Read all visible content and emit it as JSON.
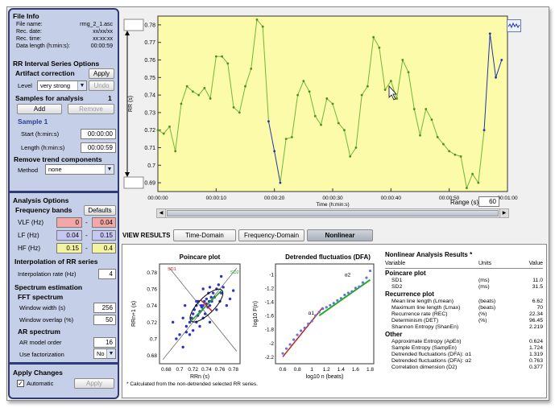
{
  "file_info": {
    "title": "File Info",
    "rows": [
      {
        "label": "File name:",
        "value": "rrng_2_1.asc"
      },
      {
        "label": "Rec. date:",
        "value": "xx/xx/xx"
      },
      {
        "label": "Rec. time:",
        "value": "xx:xx:xx"
      },
      {
        "label": "Data length (h:min:s):",
        "value": "00:00:59"
      }
    ]
  },
  "rr_options": {
    "title": "RR Interval Series Options",
    "artifact_label": "Artifact correction",
    "apply_label": "Apply",
    "level_label": "Level",
    "level_value": "very strong",
    "undo_label": "Undo",
    "samples_label": "Samples for analysis",
    "samples_count": "1",
    "add_label": "Add",
    "remove_label": "Remove",
    "sample_title": "Sample 1",
    "start_label": "Start (h:min:s)",
    "start_value": "00:00:00",
    "length_label": "Length (h:min:s)",
    "length_value": "00:00:59",
    "trend_label": "Remove trend components",
    "method_label": "Method",
    "method_value": "none"
  },
  "analysis": {
    "title": "Analysis Options",
    "freq_label": "Frequency bands",
    "defaults_label": "Defaults",
    "bands": [
      {
        "label": "VLF (Hz)",
        "lo": "0",
        "hi": "0.04",
        "color": "#f4a7a7"
      },
      {
        "label": "LF (Hz)",
        "lo": "0.04",
        "hi": "0.15",
        "color": "#c7c7f4"
      },
      {
        "label": "HF (Hz)",
        "lo": "0.15",
        "hi": "0.4",
        "color": "#f4f4a0"
      }
    ],
    "interp_title": "Interpolation of RR series",
    "interp_label": "Interpolation rate (Hz)",
    "interp_value": "4",
    "spectrum_title": "Spectrum estimation",
    "fft_title": "FFT spectrum",
    "window_label": "Window width (s)",
    "window_value": "256",
    "overlap_label": "Window overlap (%)",
    "overlap_value": "50",
    "ar_title": "AR spectrum",
    "ar_order_label": "AR model order",
    "ar_order_value": "16",
    "fact_label": "Use factorization",
    "fact_value": "No"
  },
  "apply_changes": {
    "title": "Apply Changes",
    "auto_label": "Automatic",
    "apply_label": "Apply"
  },
  "rr_plot": {
    "ylabel": "RR (s)",
    "xlabel": "Time (h:min:s)",
    "yticks": [
      "0.78",
      "0.77",
      "0.76",
      "0.75",
      "0.74",
      "0.73",
      "0.72",
      "0.71",
      "0.7",
      "0.69"
    ],
    "xticks": [
      "00:00:00",
      "00:00:10",
      "00:00:20",
      "00:00:30",
      "00:00:40",
      "00:00:50",
      "00:01:00"
    ],
    "range_label": "Range (s)",
    "range_value": "60",
    "colors": {
      "bg": "#fbfbaa",
      "line": "#6fb83a",
      "selected": "#2233aa"
    }
  },
  "view_results": {
    "label": "VIEW RESULTS",
    "tabs": [
      "Time-Domain",
      "Frequency-Domain",
      "Nonlinear"
    ],
    "active": 2
  },
  "poincare": {
    "title": "Poincare plot",
    "ylabel": "RRn+1 (s)",
    "xlabel": "RRn (s)",
    "xticks": [
      "0.68",
      "0.7",
      "0.72",
      "0.74",
      "0.76",
      "0.78"
    ],
    "yticks": [
      "0.78",
      "0.76",
      "0.74",
      "0.72",
      "0.7",
      "0.68"
    ],
    "sd1_label": "SD1",
    "sd2_label": "SD2"
  },
  "dfa": {
    "title": "Detrended fluctuatios (DFA)",
    "ylabel": "log10 F(n)",
    "xlabel": "log10 n (beats)",
    "xticks": [
      "0.6",
      "0.8",
      "1",
      "1.2",
      "1.4",
      "1.6",
      "1.8"
    ],
    "yticks": [
      "-1",
      "-1.2",
      "-1.4",
      "-1.6",
      "-1.8",
      "-2",
      "-2.2"
    ],
    "alpha1": "α1",
    "alpha2": "α2"
  },
  "nonlinear": {
    "title": "Nonlinear Analysis Results",
    "asterisk": "*",
    "headers": [
      "Variable",
      "Units",
      "Value"
    ],
    "sections": [
      {
        "title": "Poincare plot",
        "rows": [
          {
            "name": "SD1",
            "unit": "(ms)",
            "value": "11.0"
          },
          {
            "name": "SD2",
            "unit": "(ms)",
            "value": "31.5"
          }
        ]
      },
      {
        "title": "Recurrence plot",
        "rows": [
          {
            "name": "Mean line length (Lmean)",
            "unit": "(beats)",
            "value": "6.62"
          },
          {
            "name": "Maximum line length (Lmax)",
            "unit": "(beats)",
            "value": "70"
          },
          {
            "name": "Recurrence rate (REC)",
            "unit": "(%)",
            "value": "22.34"
          },
          {
            "name": "Determinism (DET)",
            "unit": "(%)",
            "value": "96.45"
          },
          {
            "name": "Shannon Entropy (ShanEn)",
            "unit": "",
            "value": "2.219"
          }
        ]
      },
      {
        "title": "Other",
        "rows": [
          {
            "name": "Approximate Entropy (ApEn)",
            "unit": "",
            "value": "0.624"
          },
          {
            "name": "Sample Entropy (SampEn)",
            "unit": "",
            "value": "1.724"
          },
          {
            "name": "Detrended fluctuations (DFA): α1",
            "unit": "",
            "value": "1.319"
          },
          {
            "name": "Detrended fluctuations (DFA): α2",
            "unit": "",
            "value": "0.763"
          },
          {
            "name": "Correlation dimension (D2)",
            "unit": "",
            "value": "0.377"
          }
        ]
      }
    ],
    "footnote": "* Calculated from the non-detrended selected RR series."
  },
  "chart_data": [
    {
      "type": "line",
      "name": "rr-series",
      "x_unit": "s",
      "xlim": [
        0,
        60
      ],
      "ylim": [
        0.685,
        0.785
      ],
      "x": [
        0,
        1,
        2,
        3,
        4,
        5,
        6,
        7,
        8,
        9,
        10,
        11,
        12,
        13,
        14,
        15,
        16,
        17,
        18,
        19,
        20,
        21,
        22,
        23,
        24,
        25,
        26,
        27,
        28,
        29,
        30,
        31,
        32,
        33,
        34,
        35,
        36,
        37,
        38,
        39,
        40,
        41,
        42,
        43,
        44,
        45,
        46,
        47,
        48,
        49,
        50,
        51,
        52,
        53,
        54,
        55,
        56,
        57,
        58,
        59
      ],
      "y": [
        0.72,
        0.718,
        0.722,
        0.708,
        0.735,
        0.745,
        0.742,
        0.74,
        0.744,
        0.738,
        0.762,
        0.762,
        0.758,
        0.733,
        0.73,
        0.745,
        0.755,
        0.783,
        0.779,
        0.725,
        0.708,
        0.69,
        0.715,
        0.716,
        0.74,
        0.748,
        0.742,
        0.728,
        0.723,
        0.738,
        0.735,
        0.724,
        0.72,
        0.705,
        0.71,
        0.74,
        0.745,
        0.773,
        0.767,
        0.743,
        0.748,
        0.738,
        0.76,
        0.753,
        0.732,
        0.717,
        0.732,
        0.726,
        0.716,
        0.712,
        0.708,
        0.706,
        0.705,
        0.687,
        0.695,
        0.69,
        0.72,
        0.775,
        0.75,
        0.76
      ],
      "selected_ranges": [
        [
          19,
          21
        ],
        [
          56,
          59
        ]
      ]
    },
    {
      "type": "scatter",
      "name": "poincare",
      "xlim": [
        0.67,
        0.79
      ],
      "ylim": [
        0.67,
        0.79
      ],
      "x": [
        0.7,
        0.705,
        0.71,
        0.71,
        0.715,
        0.718,
        0.72,
        0.72,
        0.722,
        0.725,
        0.725,
        0.727,
        0.728,
        0.73,
        0.73,
        0.732,
        0.733,
        0.735,
        0.735,
        0.737,
        0.738,
        0.74,
        0.74,
        0.742,
        0.743,
        0.744,
        0.745,
        0.745,
        0.747,
        0.748,
        0.75,
        0.752,
        0.755,
        0.758,
        0.76,
        0.762,
        0.765,
        0.77,
        0.775,
        0.78,
        0.69,
        0.695,
        0.705,
        0.715,
        0.725,
        0.735,
        0.745,
        0.755,
        0.708,
        0.762
      ],
      "y": [
        0.705,
        0.69,
        0.708,
        0.715,
        0.72,
        0.725,
        0.73,
        0.71,
        0.735,
        0.72,
        0.74,
        0.728,
        0.745,
        0.733,
        0.715,
        0.74,
        0.738,
        0.74,
        0.76,
        0.745,
        0.73,
        0.742,
        0.748,
        0.738,
        0.755,
        0.745,
        0.74,
        0.762,
        0.75,
        0.745,
        0.755,
        0.75,
        0.76,
        0.765,
        0.745,
        0.775,
        0.762,
        0.74,
        0.748,
        0.758,
        0.72,
        0.7,
        0.725,
        0.705,
        0.745,
        0.725,
        0.72,
        0.735,
        0.74,
        0.755
      ]
    },
    {
      "type": "scatter",
      "name": "dfa",
      "xlim": [
        0.5,
        1.85
      ],
      "ylim": [
        -2.3,
        -0.85
      ],
      "x": [
        0.6,
        0.65,
        0.7,
        0.75,
        0.8,
        0.85,
        0.9,
        0.95,
        1.0,
        1.05,
        1.1,
        1.15,
        1.2,
        1.25,
        1.3,
        1.35,
        1.4,
        1.45,
        1.5,
        1.55,
        1.6,
        1.65,
        1.7,
        1.75,
        1.8
      ],
      "y": [
        -2.15,
        -2.08,
        -2.02,
        -1.95,
        -1.88,
        -1.82,
        -1.78,
        -1.72,
        -1.68,
        -1.6,
        -1.55,
        -1.5,
        -1.48,
        -1.45,
        -1.42,
        -1.38,
        -1.35,
        -1.3,
        -1.27,
        -1.25,
        -1.2,
        -1.18,
        -1.12,
        -1.05,
        -0.95
      ],
      "fit_alpha1": {
        "x": [
          0.6,
          1.15
        ],
        "y": [
          -2.2,
          -1.48
        ]
      },
      "fit_alpha2": {
        "x": [
          1.1,
          1.8
        ],
        "y": [
          -1.6,
          -1.08
        ]
      }
    }
  ]
}
